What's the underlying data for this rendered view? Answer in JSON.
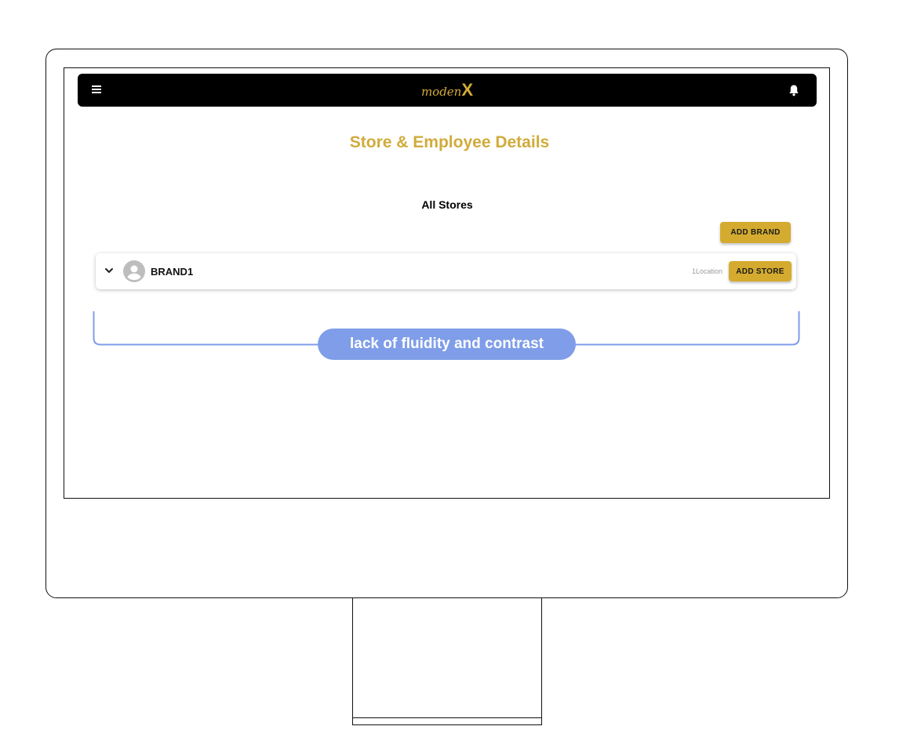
{
  "app": {
    "logo_script": "moden",
    "logo_x": "X",
    "brand_color": "#d4ab2f",
    "topbar_color": "#000000"
  },
  "header": {
    "menu_icon": "hamburger-menu-icon",
    "notification_icon": "bell-icon"
  },
  "page": {
    "title": "Store & Employee Details",
    "section_title": "All Stores",
    "add_brand_label": "ADD BRAND"
  },
  "brands": [
    {
      "name": "BRAND1",
      "location_text": "1Location",
      "add_store_label": "ADD STORE",
      "expand_icon": "chevron-down-icon",
      "avatar_icon": "person-avatar-icon"
    }
  ],
  "annotation": {
    "label": "lack of fluidity and contrast",
    "color": "#7f9de8"
  }
}
